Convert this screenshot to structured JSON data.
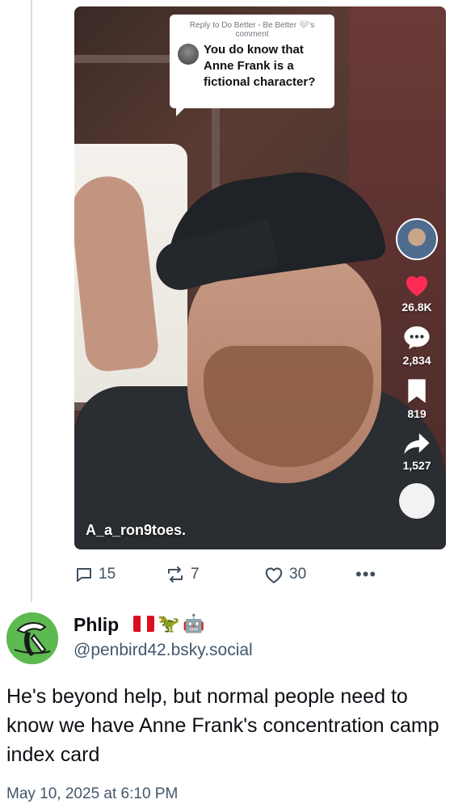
{
  "parent_post": {
    "video": {
      "reply_card": {
        "meta": "Reply to Do Better - Be Better 🤍's comment",
        "text": "You do know that Anne Frank is a fictional character?"
      },
      "creator_handle": "A_a_ron9toes.",
      "rail": {
        "likes": "26.8K",
        "comments": "2,834",
        "saves": "819",
        "shares": "1,527"
      },
      "colors": {
        "like": "#fe2c55"
      }
    },
    "actions": {
      "replies": "15",
      "reposts": "7",
      "likes": "30",
      "more": "•••"
    }
  },
  "post": {
    "author": {
      "display_name": "Phlip",
      "emoji": [
        "peru-flag",
        "🦖",
        "🤖"
      ],
      "handle": "@penbird42.bsky.social"
    },
    "text": "He's beyond help, but normal people need to know we have Anne Frank's concentration camp index card",
    "timestamp": "May 10, 2025 at 6:10 PM"
  }
}
